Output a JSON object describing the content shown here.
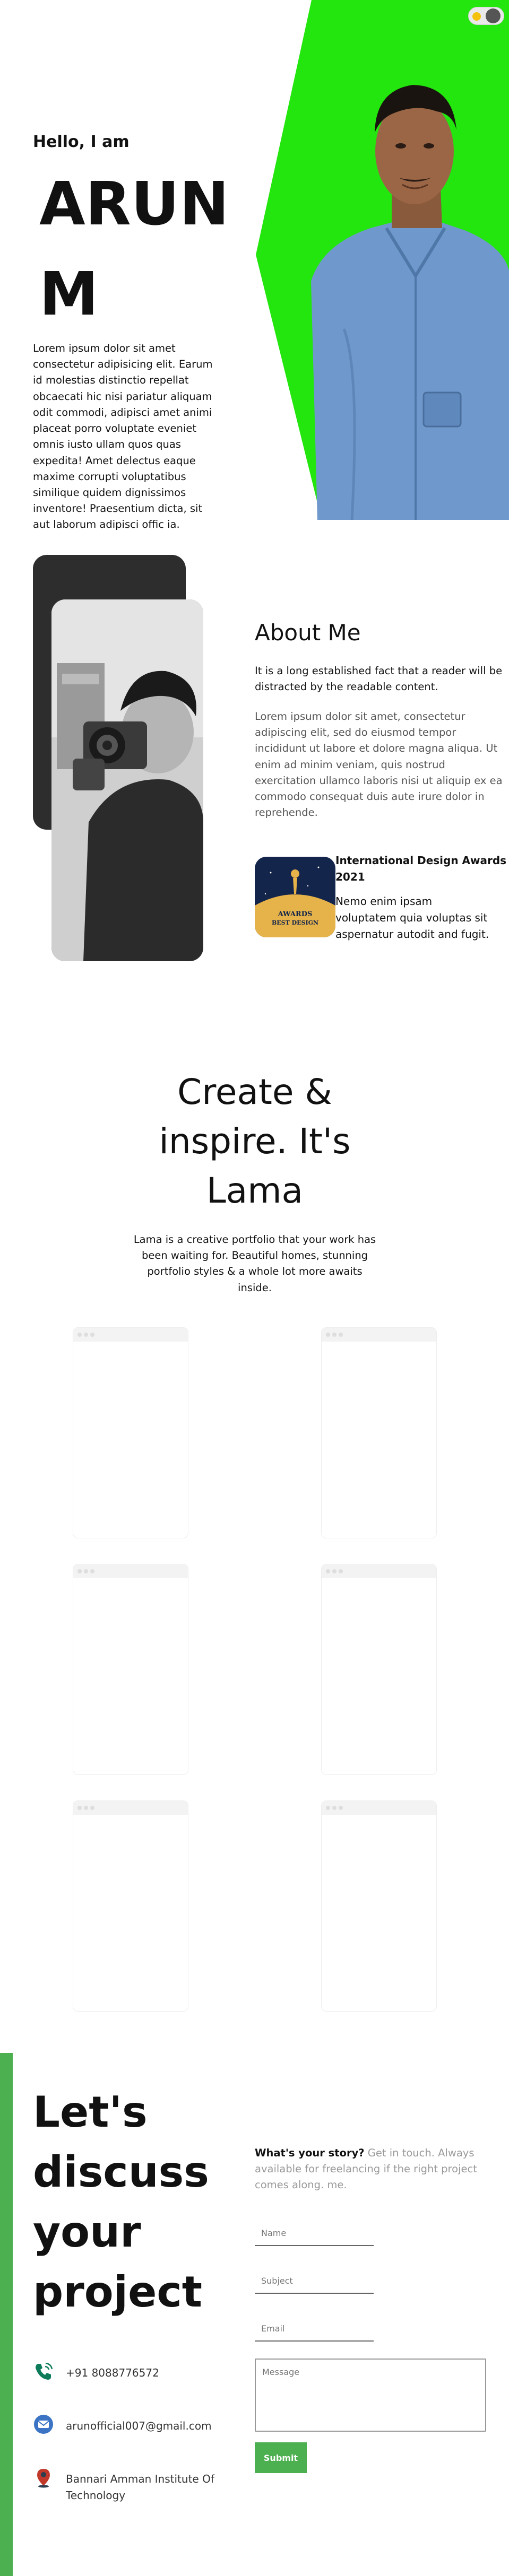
{
  "hero": {
    "greeting": "Hello, I am",
    "name": "ARUN M",
    "intro": "Lorem ipsum dolor sit amet consectetur adipisicing elit. Earum id molestias distinctio repellat obcaecati hic nisi pariatur aliquam odit commodi, adipisci amet animi placeat porro voluptate eveniet omnis iusto ullam quos quas expedita! Amet delectus eaque maxime corrupti voluptatibus similique quidem dignissimos inventore! Praesentium dicta, sit aut laborum adipisci offic ia.",
    "accent_color": "#22e60d"
  },
  "theme_toggle": {
    "icon": "sun-moon-toggle-icon"
  },
  "about": {
    "title": "About Me",
    "lead": "It is a long established fact that a reader will be distracted by the readable content.",
    "body": "Lorem ipsum dolor sit amet, consectetur adipiscing elit, sed do eiusmod tempor incididunt ut labore et dolore magna aliqua. Ut enim ad minim veniam, quis nostrud exercitation ullamco laboris nisi ut aliquip ex ea commodo consequat duis aute irure dolor in reprehende.",
    "award": {
      "title": "International Design Awards 2021",
      "text": "Nemo enim ipsam voluptatem quia voluptas sit aspernatur autodit and fugit.",
      "badge_line1": "AWARDS",
      "badge_line2": "BEST DESIGN"
    }
  },
  "create": {
    "title": "Create & inspire. It's Lama",
    "text": "Lama is a creative portfolio that your work has been waiting for. Beautiful homes, stunning portfolio styles & a whole lot more awaits inside."
  },
  "contact": {
    "heading": "Let's discuss your project",
    "phone": "+91 8088776572",
    "email": "arunofficial007@gmail.com",
    "address": "Bannari Amman Institute Of Technology",
    "story_label": "What's your story?",
    "story_text": " Get in touch. Always available for freelancing if the right project comes along. me.",
    "form": {
      "name_placeholder": "Name",
      "subject_placeholder": "Subject",
      "email_placeholder": "Email",
      "message_placeholder": "Message",
      "submit_label": "Submit"
    },
    "accent_color": "#4caf50"
  }
}
